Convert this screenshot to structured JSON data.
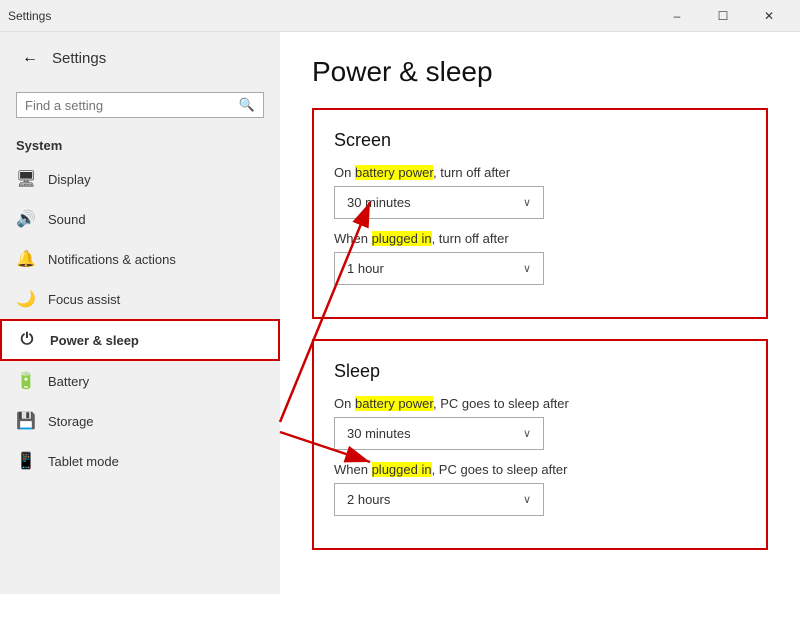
{
  "titleBar": {
    "title": "Settings",
    "minimizeLabel": "–",
    "maximizeLabel": "☐",
    "closeLabel": "✕"
  },
  "sidebar": {
    "backLabel": "←",
    "appTitle": "Settings",
    "searchPlaceholder": "Find a setting",
    "sectionLabel": "System",
    "items": [
      {
        "id": "display",
        "icon": "🖥",
        "label": "Display"
      },
      {
        "id": "sound",
        "icon": "🔊",
        "label": "Sound"
      },
      {
        "id": "notifications",
        "icon": "🔔",
        "label": "Notifications & actions"
      },
      {
        "id": "focus",
        "icon": "🌙",
        "label": "Focus assist"
      },
      {
        "id": "power",
        "icon": "⏻",
        "label": "Power & sleep"
      },
      {
        "id": "battery",
        "icon": "🔋",
        "label": "Battery"
      },
      {
        "id": "storage",
        "icon": "💾",
        "label": "Storage"
      },
      {
        "id": "tablet",
        "icon": "📱",
        "label": "Tablet mode"
      }
    ]
  },
  "content": {
    "pageTitle": "Power & sleep",
    "screen": {
      "heading": "Screen",
      "batteryLabel1": "On ",
      "batteryHighlight": "battery power",
      "batteryLabel2": ", turn off after",
      "batteryDropdownValue": "30 minutes",
      "pluggedLabel1": "When ",
      "pluggedHighlight": "plugged in",
      "pluggedLabel2": ", turn off after",
      "pluggedDropdownValue": "1 hour"
    },
    "sleep": {
      "heading": "Sleep",
      "batteryLabel1": "On ",
      "batteryHighlight": "battery power",
      "batteryLabel2": ", PC goes to sleep after",
      "batteryDropdownValue": "30 minutes",
      "pluggedLabel1": "When ",
      "pluggedHighlight": "plugged in",
      "pluggedLabel2": ", PC goes to sleep after",
      "pluggedDropdownValue": "2 hours"
    }
  }
}
